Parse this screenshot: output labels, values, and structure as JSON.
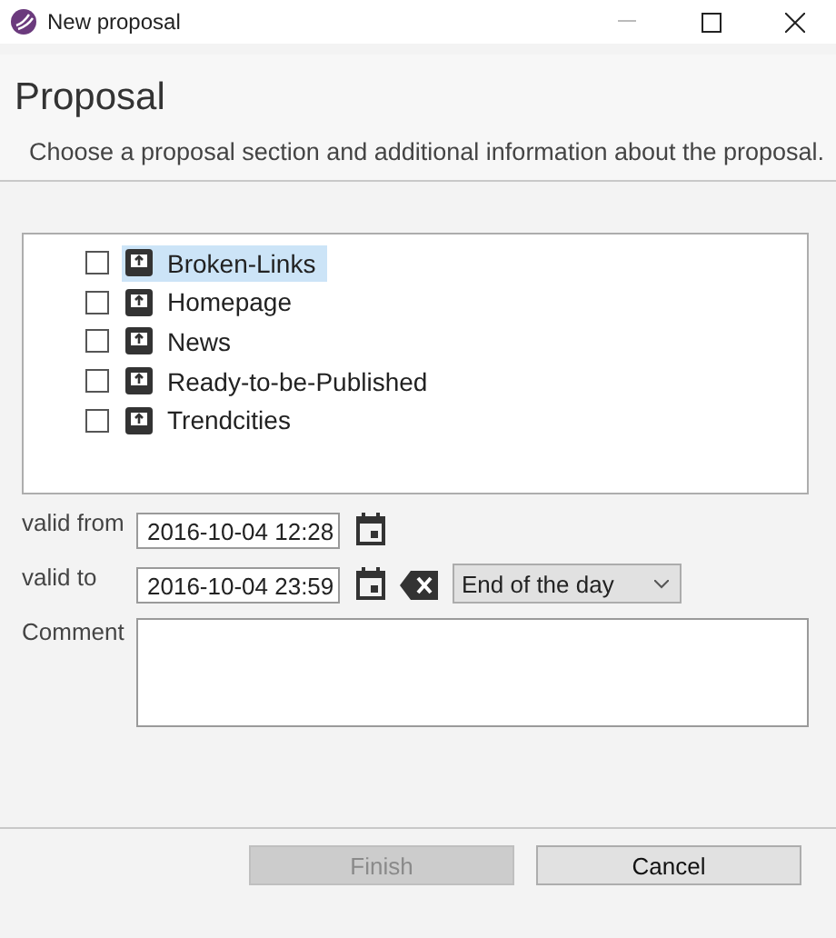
{
  "window": {
    "title": "New proposal"
  },
  "header": {
    "title": "Proposal",
    "description": "Choose a proposal section and additional information about the proposal."
  },
  "sections": [
    {
      "label": "Broken-Links",
      "checked": false,
      "selected": true
    },
    {
      "label": "Homepage",
      "checked": false,
      "selected": false
    },
    {
      "label": "News",
      "checked": false,
      "selected": false
    },
    {
      "label": "Ready-to-be-Published",
      "checked": false,
      "selected": false
    },
    {
      "label": "Trendcities",
      "checked": false,
      "selected": false
    }
  ],
  "valid_from": {
    "label": "valid from",
    "value": "2016-10-04 12:28"
  },
  "valid_to": {
    "label": "valid to",
    "value": "2016-10-04 23:59",
    "preset": "End of the day"
  },
  "comment": {
    "label": "Comment"
  },
  "buttons": [
    {
      "label": "Finish",
      "disabled": true
    },
    {
      "label": "Cancel",
      "disabled": false
    }
  ]
}
